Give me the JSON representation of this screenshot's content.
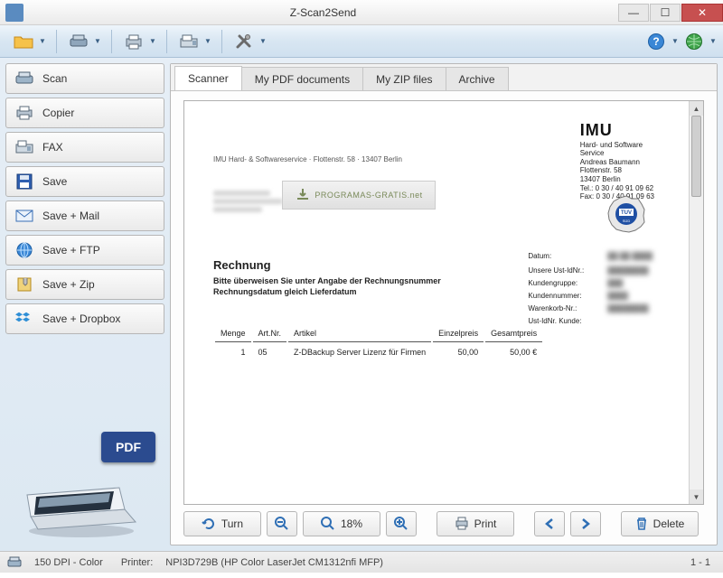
{
  "window": {
    "title": "Z-Scan2Send"
  },
  "toolbar_icons": [
    "folder",
    "scanner",
    "printer",
    "fax",
    "tools",
    "help",
    "globe"
  ],
  "sidebar": {
    "items": [
      {
        "label": "Scan",
        "icon": "scanner"
      },
      {
        "label": "Copier",
        "icon": "printer"
      },
      {
        "label": "FAX",
        "icon": "fax"
      },
      {
        "label": "Save",
        "icon": "floppy"
      },
      {
        "label": "Save + Mail",
        "icon": "mail"
      },
      {
        "label": "Save + FTP",
        "icon": "globe"
      },
      {
        "label": "Save + Zip",
        "icon": "zip"
      },
      {
        "label": "Save + Dropbox",
        "icon": "dropbox"
      }
    ],
    "pdf_badge": "PDF"
  },
  "tabs": [
    {
      "label": "Scanner",
      "active": true
    },
    {
      "label": "My PDF documents"
    },
    {
      "label": "My ZIP files"
    },
    {
      "label": "Archive"
    }
  ],
  "preview_toolbar": {
    "turn": "Turn",
    "zoom_pct": "18%",
    "print": "Print",
    "delete": "Delete"
  },
  "status": {
    "dpi": "150 DPI - Color",
    "printer_label": "Printer:",
    "printer_name": "NPI3D729B (HP Color LaserJet CM1312nfi MFP)",
    "page": "1 - 1"
  },
  "document": {
    "topline": "IMU Hard- & Softwareservice · Flottenstr. 58 · 13407 Berlin",
    "company": "IMU",
    "company_sub1": "Hard- und Software",
    "company_sub2": "Service",
    "contact_name": "Andreas Baumann",
    "contact_street": "Flottenstr. 58",
    "contact_city": "13407 Berlin",
    "contact_tel": "Tel.: 0 30 / 40 91 09 62",
    "contact_fax": "Fax: 0 30 / 40 91 09 63",
    "heading": "Rechnung",
    "sub1": "Bitte überweisen Sie unter Angabe der Rechnungsnummer",
    "sub2": "Rechnungsdatum gleich Lieferdatum",
    "meta_labels": {
      "datum": "Datum:",
      "ust": "Unsere Ust-IdNr.:",
      "kg": "Kundengruppe:",
      "kn": "Kundennummer:",
      "wk": "Warenkorb-Nr.:",
      "ukn": "Ust-IdNr. Kunde:"
    },
    "table": {
      "headers": {
        "menge": "Menge",
        "artnr": "Art.Nr.",
        "artikel": "Artikel",
        "ep": "Einzelpreis",
        "gp": "Gesamtpreis"
      },
      "rows": [
        {
          "menge": "1",
          "artnr": "05",
          "artikel": "Z-DBackup Server Lizenz für Firmen",
          "ep": "50,00",
          "gp": "50,00 €"
        }
      ]
    },
    "watermark": "PROGRAMAS-GRATIS.net"
  }
}
